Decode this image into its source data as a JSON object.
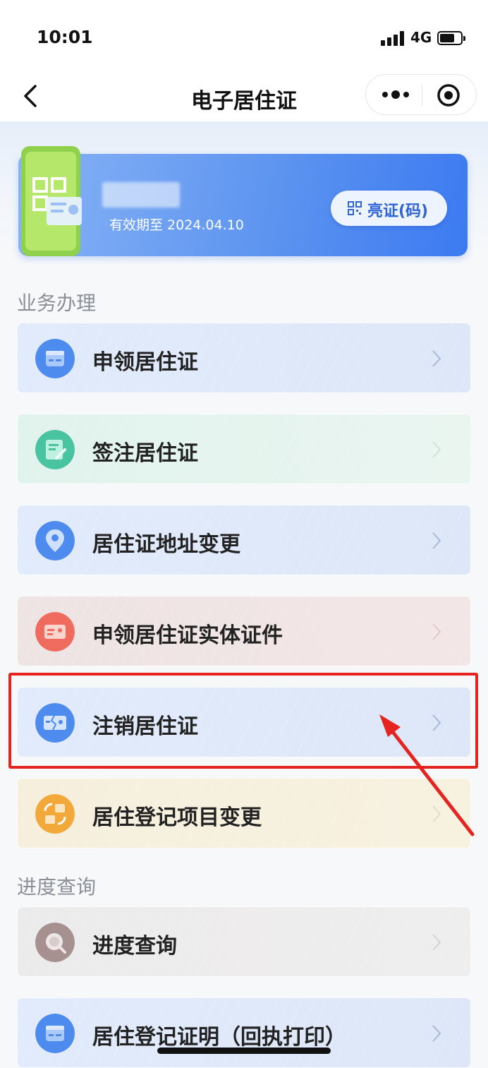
{
  "status_bar": {
    "time": "10:01",
    "network": "4G"
  },
  "nav": {
    "title": "电子居住证",
    "back_icon": "chevron-left-icon",
    "more_icon": "more-dots-icon",
    "close_icon": "target-circle-icon"
  },
  "card": {
    "valid_text": "有效期至 2024.04.10",
    "qr_button_label": "亮证(码)",
    "qr_icon": "qr-code-icon"
  },
  "sections": {
    "business": {
      "title": "业务办理"
    },
    "progress": {
      "title": "进度查询"
    }
  },
  "items": [
    {
      "label": "申领居住证",
      "icon": "id-card-icon",
      "color": "#4d8bef"
    },
    {
      "label": "签注居住证",
      "icon": "document-edit-icon",
      "color": "#4ac3a1"
    },
    {
      "label": "居住证地址变更",
      "icon": "location-pin-icon",
      "color": "#4d8bef"
    },
    {
      "label": "申领居住证实体证件",
      "icon": "physical-card-icon",
      "color": "#ef6b5d"
    },
    {
      "label": "注销居住证",
      "icon": "broken-card-icon",
      "color": "#4d8bef"
    },
    {
      "label": "居住登记项目变更",
      "icon": "swap-icon",
      "color": "#f3a93a"
    },
    {
      "label": "进度查询",
      "icon": "search-icon",
      "color": "#a79090"
    },
    {
      "label": "居住登记证明（回执打印）",
      "icon": "certificate-icon",
      "color": "#4d8bef"
    }
  ],
  "colors": {
    "accent": "#3c7af1",
    "annotation": "#e5231f"
  }
}
